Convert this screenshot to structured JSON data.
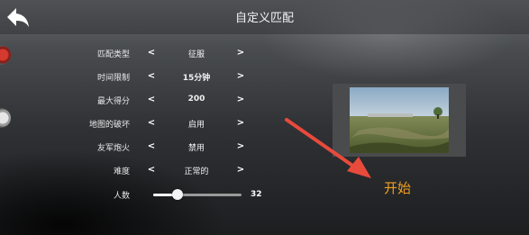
{
  "header": {
    "title": "自定义匹配"
  },
  "options": [
    {
      "label": "匹配类型",
      "value": "征服"
    },
    {
      "label": "时间限制",
      "value": "15分钟"
    },
    {
      "label": "最大得分",
      "value": "200"
    },
    {
      "label": "地图的破坏",
      "value": "启用"
    },
    {
      "label": "友军炮火",
      "value": "禁用"
    },
    {
      "label": "难度",
      "value": "正常的"
    }
  ],
  "player_count": {
    "label": "人数",
    "value": "32",
    "fraction": 0.28
  },
  "arrows": {
    "prev": "<",
    "next": ">"
  },
  "start_label": "开始",
  "colors": {
    "start": "#f0a020",
    "annotation_arrow": "#e84a3c"
  }
}
